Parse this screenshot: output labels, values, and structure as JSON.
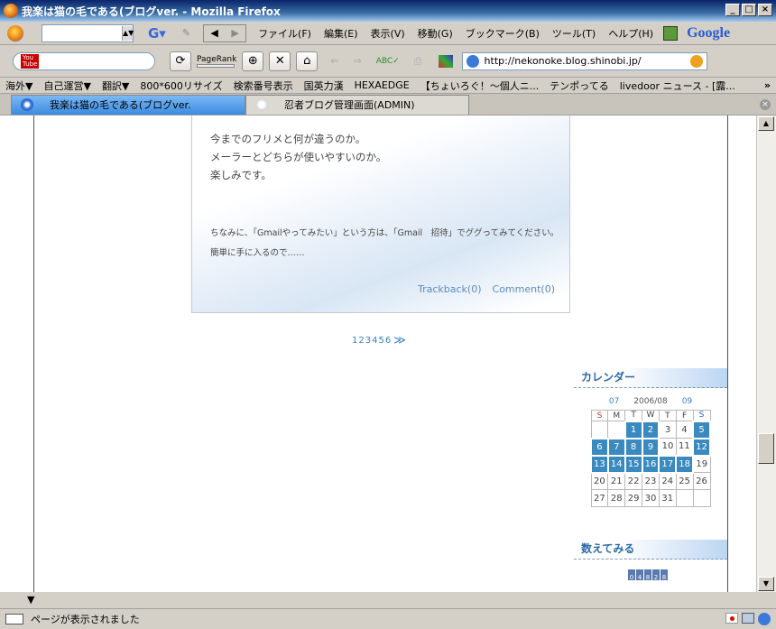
{
  "window": {
    "title": "我楽は猫の毛である(ブログver. - Mozilla Firefox"
  },
  "menubar": {
    "search_placeholder": "",
    "items": [
      "ファイル(F)",
      "編集(E)",
      "表示(V)",
      "移動(G)",
      "ブックマーク(B)",
      "ツール(T)",
      "ヘルプ(H)"
    ],
    "google_label": "Google"
  },
  "navbar": {
    "youtube_label": "You Tube",
    "pagerank_label": "PageRank",
    "url": "http://nekonoke.blog.shinobi.jp/"
  },
  "bookmarks": [
    "海外▼",
    "自己運営▼",
    "翻訳▼",
    "800*600リサイズ",
    "検索番号表示",
    "国英力漢",
    "HEXAEDGE",
    "【ちょいろぐ！〜個人ニ...",
    "テンポってる",
    "livedoor ニュース - [露..."
  ],
  "tabs": [
    {
      "label": "我楽は猫の毛である(ブログver."
    },
    {
      "label": "忍者ブログ管理画面(ADMIN)"
    }
  ],
  "entry": {
    "lines": [
      "今までのフリメと何が違うのか。",
      "メーラーとどちらが使いやすいのか。",
      "楽しみです。"
    ],
    "note1": "ちなみに、「Gmailやってみたい」という方は、「Gmail　招待」でググってみてください。",
    "note2": "簡単に手に入るので……",
    "trackback": "Trackback(0)",
    "comment": "Comment(0)"
  },
  "pager": {
    "pages": [
      "1",
      "2",
      "3",
      "4",
      "5",
      "6"
    ],
    "next": "≫"
  },
  "calendar": {
    "heading": "カレンダー",
    "prev": "07",
    "month": "2006/08",
    "next": "09",
    "weekdays": [
      "S",
      "M",
      "T",
      "W",
      "T",
      "F",
      "S"
    ],
    "weeks": [
      [
        "",
        "",
        "1",
        "2",
        "3",
        "4",
        "5"
      ],
      [
        "6",
        "7",
        "8",
        "9",
        "10",
        "11",
        "12"
      ],
      [
        "13",
        "14",
        "15",
        "16",
        "17",
        "18",
        "19"
      ],
      [
        "20",
        "21",
        "22",
        "23",
        "24",
        "25",
        "26"
      ],
      [
        "27",
        "28",
        "29",
        "30",
        "31",
        "",
        ""
      ]
    ],
    "linked_days": [
      "1",
      "2",
      "5",
      "6",
      "7",
      "8",
      "9",
      "12",
      "13",
      "14",
      "15",
      "16",
      "17",
      "18"
    ]
  },
  "counter": {
    "heading": "数えてみる",
    "digits": [
      "0",
      "4",
      "8",
      "2",
      "8"
    ]
  },
  "status": {
    "text": "ページが表示されました"
  }
}
